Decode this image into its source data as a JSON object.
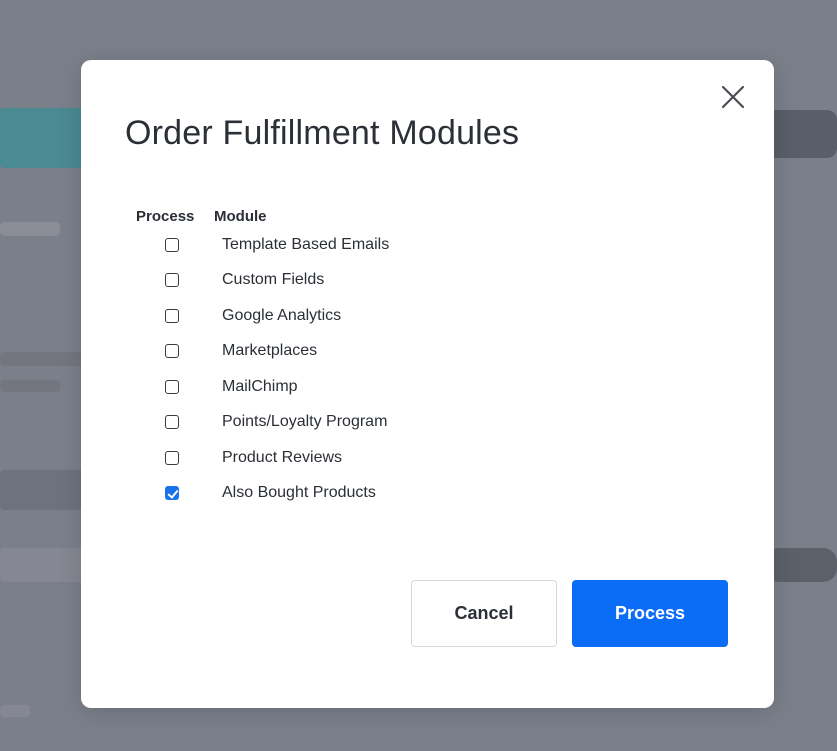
{
  "dialog": {
    "title": "Order Fulfillment Modules",
    "close_icon": "close-icon"
  },
  "table": {
    "headers": {
      "process": "Process",
      "module": "Module"
    },
    "rows": [
      {
        "label": "Template Based Emails",
        "checked": false
      },
      {
        "label": "Custom Fields",
        "checked": false
      },
      {
        "label": "Google Analytics",
        "checked": false
      },
      {
        "label": "Marketplaces",
        "checked": false
      },
      {
        "label": "MailChimp",
        "checked": false
      },
      {
        "label": "Points/Loyalty Program",
        "checked": false
      },
      {
        "label": "Product Reviews",
        "checked": false
      },
      {
        "label": "Also Bought Products",
        "checked": true
      }
    ]
  },
  "buttons": {
    "cancel_label": "Cancel",
    "process_label": "Process"
  },
  "colors": {
    "primary": "#0b6cf5",
    "checkbox_checked": "#1a73e8",
    "overlay": "#7b7f8a"
  }
}
